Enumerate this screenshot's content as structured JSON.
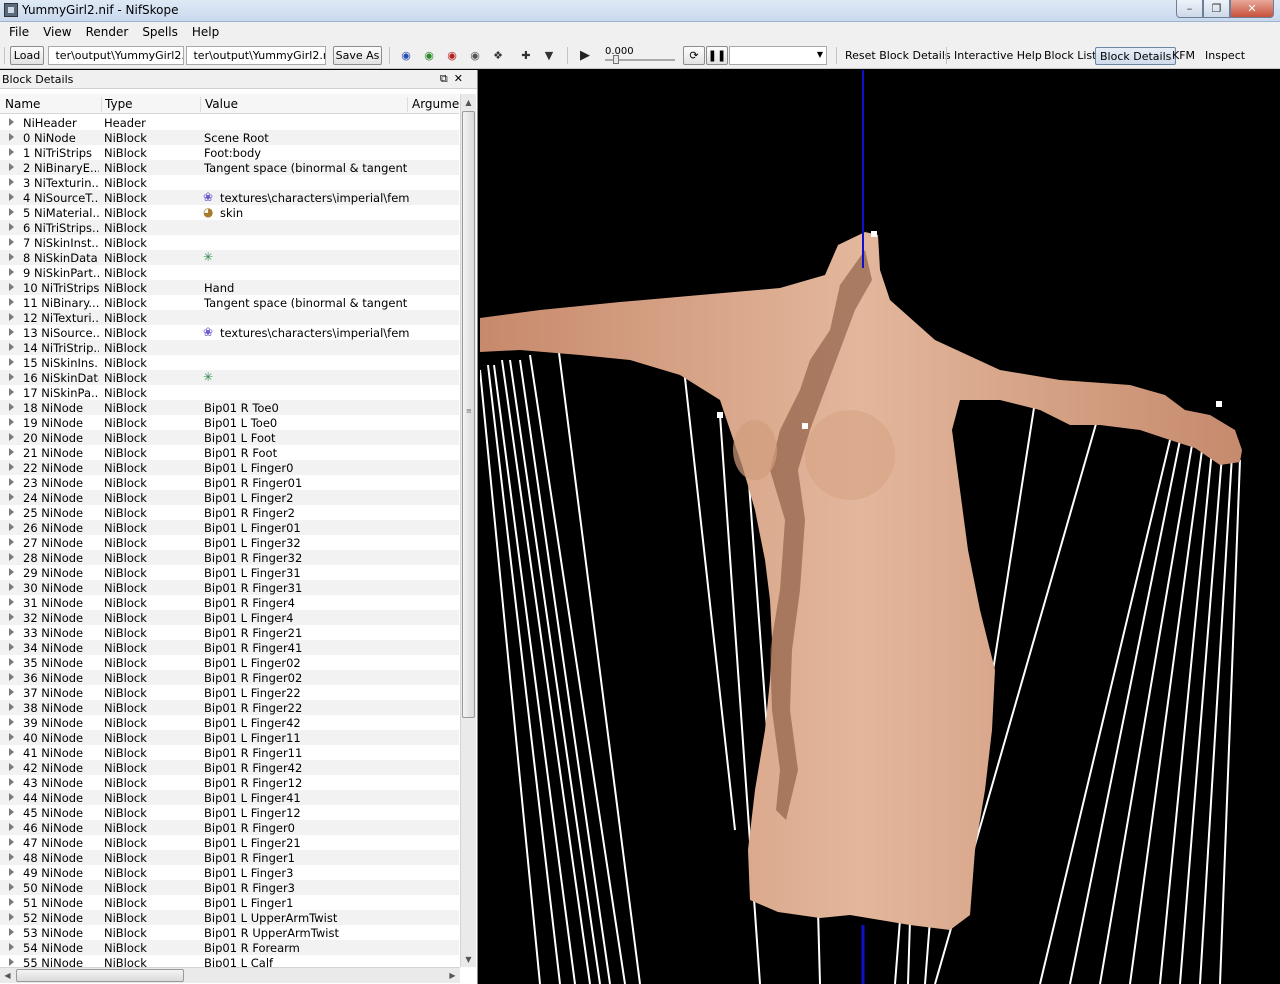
{
  "window": {
    "title": "YummyGirl2.nif - NifSkope"
  },
  "menu": [
    {
      "label": "File"
    },
    {
      "label": "View"
    },
    {
      "label": "Render"
    },
    {
      "label": "Spells"
    },
    {
      "label": "Help"
    }
  ],
  "toolbar": {
    "load_label": "Load",
    "load_path": " ter\\output\\YummyGirl2.nif",
    "save_path": " ter\\output\\YummyGirl2.nif",
    "save_as_label": "Save As",
    "time_value": "0.000",
    "reset_block_details": "Reset Block Details",
    "interactive_help": "Interactive Help",
    "block_list": "Block List",
    "block_details": "Block Details",
    "kfm": "KFM",
    "inspect": "Inspect"
  },
  "panel": {
    "title": "Block Details",
    "columns": [
      "Name",
      "Type",
      "Value",
      "Argume"
    ],
    "rows": [
      {
        "name": "NiHeader",
        "type": "Header",
        "value": ""
      },
      {
        "name": "0 NiNode",
        "type": "NiBlock",
        "value": "Scene Root"
      },
      {
        "name": "1 NiTriStrips",
        "type": "NiBlock",
        "value": "Foot:body"
      },
      {
        "name": "2 NiBinaryE...",
        "type": "NiBlock",
        "value": "Tangent space (binormal & tangent ..."
      },
      {
        "name": "3 NiTexturin...",
        "type": "NiBlock",
        "value": ""
      },
      {
        "name": "4 NiSourceT...",
        "type": "NiBlock",
        "value": "textures\\characters\\imperial\\fem...",
        "icon": "texture-icon"
      },
      {
        "name": "5 NiMaterial...",
        "type": "NiBlock",
        "value": "skin",
        "icon": "material-icon"
      },
      {
        "name": "6 NiTriStrips...",
        "type": "NiBlock",
        "value": ""
      },
      {
        "name": "7 NiSkinInst...",
        "type": "NiBlock",
        "value": ""
      },
      {
        "name": "8 NiSkinData",
        "type": "NiBlock",
        "value": "",
        "icon": "skin-data-icon"
      },
      {
        "name": "9 NiSkinPart...",
        "type": "NiBlock",
        "value": ""
      },
      {
        "name": "10 NiTriStrips",
        "type": "NiBlock",
        "value": "Hand"
      },
      {
        "name": "11 NiBinary...",
        "type": "NiBlock",
        "value": "Tangent space (binormal & tangent ..."
      },
      {
        "name": "12 NiTexturi...",
        "type": "NiBlock",
        "value": ""
      },
      {
        "name": "13 NiSource...",
        "type": "NiBlock",
        "value": "textures\\characters\\imperial\\fem...",
        "icon": "texture-icon"
      },
      {
        "name": "14 NiTriStrip...",
        "type": "NiBlock",
        "value": ""
      },
      {
        "name": "15 NiSkinIns...",
        "type": "NiBlock",
        "value": ""
      },
      {
        "name": "16 NiSkinData",
        "type": "NiBlock",
        "value": "",
        "icon": "skin-data-icon"
      },
      {
        "name": "17 NiSkinPa...",
        "type": "NiBlock",
        "value": ""
      },
      {
        "name": "18 NiNode",
        "type": "NiBlock",
        "value": "Bip01 R Toe0"
      },
      {
        "name": "19 NiNode",
        "type": "NiBlock",
        "value": "Bip01 L Toe0"
      },
      {
        "name": "20 NiNode",
        "type": "NiBlock",
        "value": "Bip01 L Foot"
      },
      {
        "name": "21 NiNode",
        "type": "NiBlock",
        "value": "Bip01 R Foot"
      },
      {
        "name": "22 NiNode",
        "type": "NiBlock",
        "value": "Bip01 L Finger0"
      },
      {
        "name": "23 NiNode",
        "type": "NiBlock",
        "value": "Bip01 R Finger01"
      },
      {
        "name": "24 NiNode",
        "type": "NiBlock",
        "value": "Bip01 L Finger2"
      },
      {
        "name": "25 NiNode",
        "type": "NiBlock",
        "value": "Bip01 R Finger2"
      },
      {
        "name": "26 NiNode",
        "type": "NiBlock",
        "value": "Bip01 L Finger01"
      },
      {
        "name": "27 NiNode",
        "type": "NiBlock",
        "value": "Bip01 L Finger32"
      },
      {
        "name": "28 NiNode",
        "type": "NiBlock",
        "value": "Bip01 R Finger32"
      },
      {
        "name": "29 NiNode",
        "type": "NiBlock",
        "value": "Bip01 L Finger31"
      },
      {
        "name": "30 NiNode",
        "type": "NiBlock",
        "value": "Bip01 R Finger31"
      },
      {
        "name": "31 NiNode",
        "type": "NiBlock",
        "value": "Bip01 R Finger4"
      },
      {
        "name": "32 NiNode",
        "type": "NiBlock",
        "value": "Bip01 L Finger4"
      },
      {
        "name": "33 NiNode",
        "type": "NiBlock",
        "value": "Bip01 R Finger21"
      },
      {
        "name": "34 NiNode",
        "type": "NiBlock",
        "value": "Bip01 R Finger41"
      },
      {
        "name": "35 NiNode",
        "type": "NiBlock",
        "value": "Bip01 L Finger02"
      },
      {
        "name": "36 NiNode",
        "type": "NiBlock",
        "value": "Bip01 R Finger02"
      },
      {
        "name": "37 NiNode",
        "type": "NiBlock",
        "value": "Bip01 L Finger22"
      },
      {
        "name": "38 NiNode",
        "type": "NiBlock",
        "value": "Bip01 R Finger22"
      },
      {
        "name": "39 NiNode",
        "type": "NiBlock",
        "value": "Bip01 L Finger42"
      },
      {
        "name": "40 NiNode",
        "type": "NiBlock",
        "value": "Bip01 L Finger11"
      },
      {
        "name": "41 NiNode",
        "type": "NiBlock",
        "value": "Bip01 R Finger11"
      },
      {
        "name": "42 NiNode",
        "type": "NiBlock",
        "value": "Bip01 R Finger42"
      },
      {
        "name": "43 NiNode",
        "type": "NiBlock",
        "value": "Bip01 R Finger12"
      },
      {
        "name": "44 NiNode",
        "type": "NiBlock",
        "value": "Bip01 L Finger41"
      },
      {
        "name": "45 NiNode",
        "type": "NiBlock",
        "value": "Bip01 L Finger12"
      },
      {
        "name": "46 NiNode",
        "type": "NiBlock",
        "value": "Bip01 R Finger0"
      },
      {
        "name": "47 NiNode",
        "type": "NiBlock",
        "value": "Bip01 L Finger21"
      },
      {
        "name": "48 NiNode",
        "type": "NiBlock",
        "value": "Bip01 R Finger1"
      },
      {
        "name": "49 NiNode",
        "type": "NiBlock",
        "value": "Bip01 L Finger3"
      },
      {
        "name": "50 NiNode",
        "type": "NiBlock",
        "value": "Bip01 R Finger3"
      },
      {
        "name": "51 NiNode",
        "type": "NiBlock",
        "value": "Bip01 L Finger1"
      },
      {
        "name": "52 NiNode",
        "type": "NiBlock",
        "value": "Bip01 L UpperArmTwist"
      },
      {
        "name": "53 NiNode",
        "type": "NiBlock",
        "value": "Bip01 R UpperArmTwist"
      },
      {
        "name": "54 NiNode",
        "type": "NiBlock",
        "value": "Bip01 R Forearm"
      },
      {
        "name": "55 NiNode",
        "type": "NiBlock",
        "value": "Bip01 L Calf"
      }
    ]
  },
  "viewport": {
    "background": "#000000",
    "axis_color": "#1010cc",
    "skin_color": "#d9a58a",
    "bone_color": "#ffffff"
  }
}
